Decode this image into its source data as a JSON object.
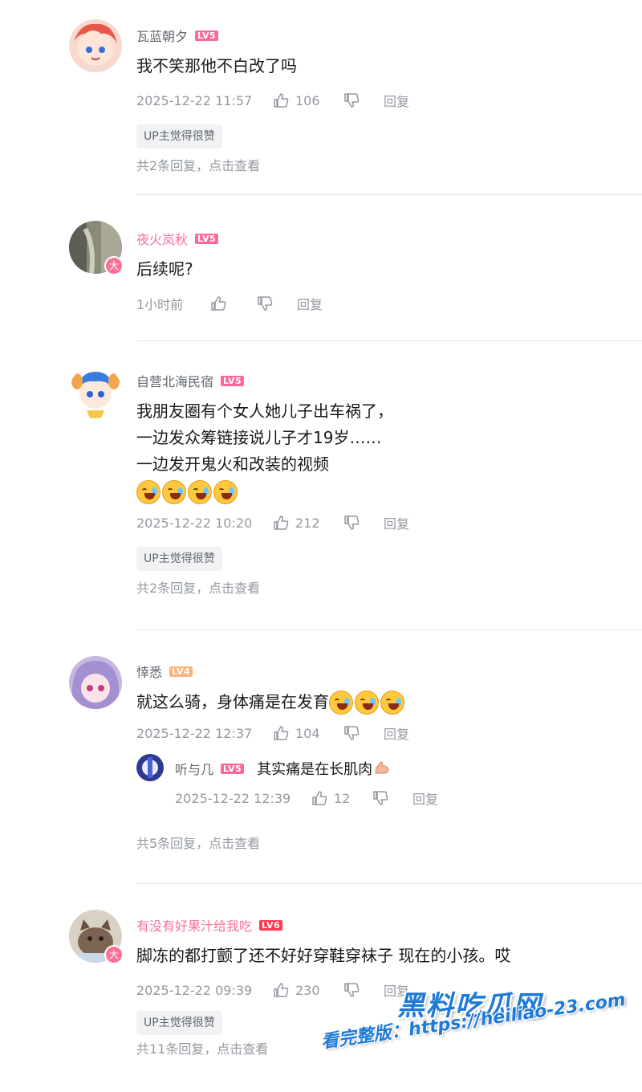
{
  "colors": {
    "text_primary": "#18191c",
    "text_secondary": "#61666d",
    "text_meta": "#9499a0",
    "vip_pink": "#fb7299",
    "watermark_blue": "#1f7ad6"
  },
  "comments": [
    {
      "username": "瓦蓝朝夕",
      "level": "LV5",
      "vip": false,
      "lines": [
        "我不笑那他不白改了吗"
      ],
      "time": "2025-12-22 11:57",
      "likes": "106",
      "reply_label": "回复",
      "up_tag": "UP主觉得很赞",
      "view_replies": "共2条回复，点击查看"
    },
    {
      "username": "夜火岚秋",
      "level": "LV5",
      "vip": true,
      "vip_badge": "大",
      "lines": [
        "后续呢?"
      ],
      "time": "1小时前",
      "reply_label": "回复"
    },
    {
      "username": "自营北海民宿",
      "level": "LV5",
      "vip": false,
      "lines": [
        "我朋友圈有个女人她儿子出车祸了，",
        "一边发众筹链接说儿子才19岁……",
        "一边发开鬼火和改装的视频"
      ],
      "emoji_count": 4,
      "emoji_name": "crying-laughing-emoji",
      "time": "2025-12-22 10:20",
      "likes": "212",
      "reply_label": "回复",
      "up_tag": "UP主觉得很赞",
      "view_replies": "共2条回复，点击查看"
    },
    {
      "username": "悻悉",
      "level": "LV4",
      "vip": false,
      "lines": [
        "就这么骑，身体痛是在发育"
      ],
      "emoji_count": 3,
      "emoji_name": "crying-laughing-emoji",
      "time": "2025-12-22 12:37",
      "likes": "104",
      "reply_label": "回复",
      "sub_reply": {
        "username": "听与几",
        "level": "LV5",
        "text": "其实痛是在长肌肉",
        "emoji_name": "flexed-biceps-emoji",
        "time": "2025-12-22 12:39",
        "likes": "12",
        "reply_label": "回复"
      },
      "view_replies": "共5条回复，点击查看"
    },
    {
      "username": "有没有好果汁给我吃",
      "level": "LV6",
      "vip": true,
      "vip_badge": "大",
      "lines": [
        "脚冻的都打颤了还不好好穿鞋穿袜子 现在的小孩。哎"
      ],
      "time": "2025-12-22 09:39",
      "likes": "230",
      "reply_label": "回复",
      "up_tag": "UP主觉得很赞",
      "view_replies": "共11条回复，点击查看"
    }
  ],
  "watermark": {
    "title": "黑料吃瓜网",
    "url": "看完整版：https://heiliao-23.com"
  }
}
